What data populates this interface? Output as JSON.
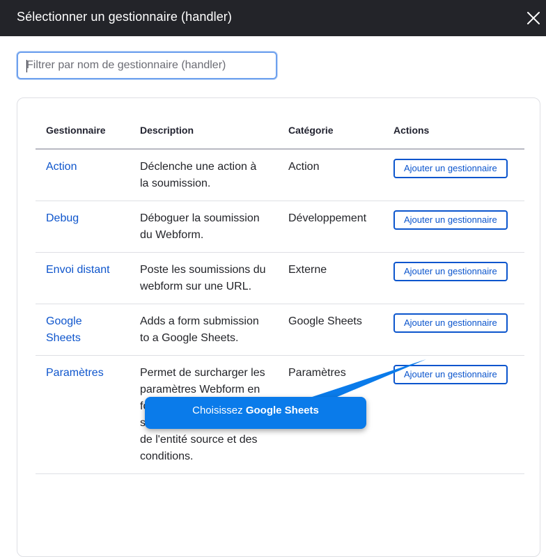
{
  "dialog": {
    "title": "Sélectionner un gestionnaire (handler)",
    "close_icon": "close-icon"
  },
  "filter": {
    "placeholder": "Filtrer par nom de gestionnaire (handler)",
    "value": ""
  },
  "table": {
    "headers": [
      "Gestionnaire",
      "Description",
      "Catégorie",
      "Actions"
    ],
    "rows": [
      {
        "name": "Action",
        "description": "Déclenche une action à la soumission.",
        "category": "Action",
        "action": "Ajouter un gestionnaire"
      },
      {
        "name": "Debug",
        "description": "Déboguer la soumission du Webform.",
        "category": "Développement",
        "action": "Ajouter un gestionnaire"
      },
      {
        "name": "Envoi distant",
        "description": "Poste les soumissions du webform sur une URL.",
        "category": "Externe",
        "action": "Ajouter un gestionnaire"
      },
      {
        "name": "Google Sheets",
        "description": "Adds a form submis­sion to a Google Sheets.",
        "category": "Google Sheets",
        "action": "Ajouter un gestionnaire"
      },
      {
        "name": "Paramètres",
        "description": "Permet de surcharger les paramètres Webform en fonction des données soumises, des champs de l'entité source et des condi­tions.",
        "category": "Paramètres",
        "action": "Ajouter un gestionnaire"
      }
    ]
  },
  "tooltip": {
    "prefix": "Choisissez",
    "target": "Google Sheets"
  },
  "colors": {
    "titlebar": "#232429",
    "link": "#0e55cc",
    "button": "#0b55cd",
    "tooltip": "#0a7bea",
    "focus_ring": "#6ea1ee"
  }
}
